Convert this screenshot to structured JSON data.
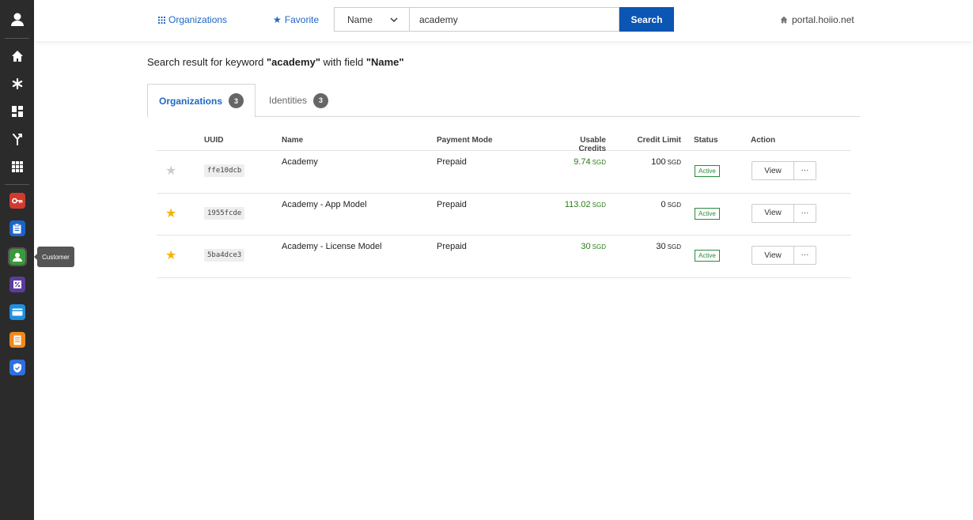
{
  "colors": {
    "sidebar_bg": "#2b2b2b",
    "link_blue": "#1f67c4",
    "search_btn": "#0b55b3",
    "credit_green": "#2a7a1a",
    "status_green": "#2a8a3a",
    "star_gold": "#f4b400",
    "star_grey": "#cccccc"
  },
  "sidebar": {
    "top_icons": [
      "user-avatar-icon",
      "home-icon",
      "asterisk-icon",
      "dashboard-icon",
      "fork-icon",
      "apps-grid-icon"
    ],
    "apps": [
      {
        "icon": "key-app-icon",
        "color": "#d23a2f"
      },
      {
        "icon": "clipboard-app-icon",
        "color": "#1c63c9"
      },
      {
        "icon": "customer-app-icon",
        "color": "#3a9a3a"
      },
      {
        "icon": "percent-app-icon",
        "color": "#5b3c9e"
      },
      {
        "icon": "card-app-icon",
        "color": "#1e8fe0"
      },
      {
        "icon": "receipt-app-icon",
        "color": "#f0891a"
      },
      {
        "icon": "shield-app-icon",
        "color": "#2f6fe0"
      }
    ],
    "tooltip": "Customer"
  },
  "header": {
    "organizations_link": "Organizations",
    "favorite_link": "Favorite",
    "field_select": "Name",
    "search_value": "academy",
    "search_button": "Search",
    "portal": "portal.hoiio.net"
  },
  "result": {
    "prefix": "Search result for keyword ",
    "keyword": "\"academy\"",
    "middle": " with field ",
    "field": "\"Name\""
  },
  "tabs": [
    {
      "label": "Organizations",
      "count": "3"
    },
    {
      "label": "Identities",
      "count": "3"
    }
  ],
  "table": {
    "headers": [
      "UUID",
      "Name",
      "Payment Mode",
      "Usable Credits",
      "Credit Limit",
      "Status",
      "Action"
    ],
    "rows": [
      {
        "favorite": false,
        "uuid": "ffe10dcb",
        "name": "Academy",
        "payment": "Prepaid",
        "credits": "9.74",
        "credits_unit": "SGD",
        "limit": "100",
        "limit_unit": "SGD",
        "status": "Active",
        "view": "View",
        "more": "···"
      },
      {
        "favorite": true,
        "uuid": "1955fcde",
        "name": "Academy - App Model",
        "payment": "Prepaid",
        "credits": "113.02",
        "credits_unit": "SGD",
        "limit": "0",
        "limit_unit": "SGD",
        "status": "Active",
        "view": "View",
        "more": "···"
      },
      {
        "favorite": true,
        "uuid": "5ba4dce3",
        "name": "Academy - License Model",
        "payment": "Prepaid",
        "credits": "30",
        "credits_unit": "SGD",
        "limit": "30",
        "limit_unit": "SGD",
        "status": "Active",
        "view": "View",
        "more": "···"
      }
    ]
  }
}
